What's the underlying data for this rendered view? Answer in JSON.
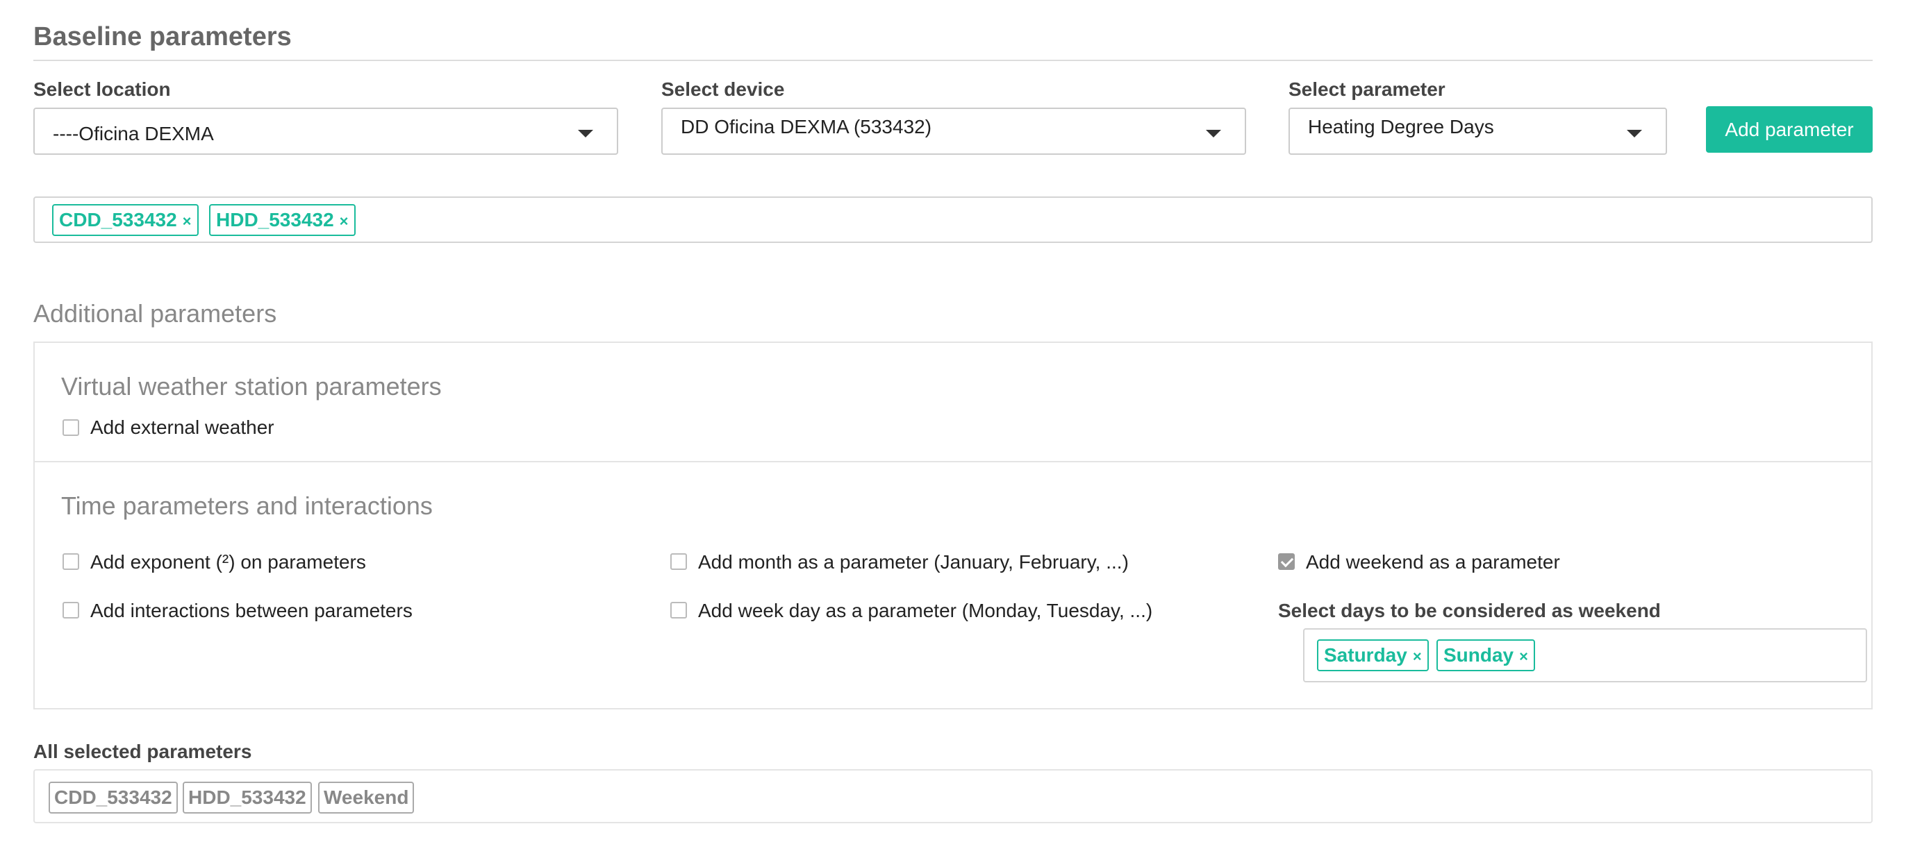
{
  "baseline": {
    "title": "Baseline parameters",
    "location": {
      "label": "Select location",
      "value": "----Oficina DEXMA"
    },
    "device": {
      "label": "Select device",
      "value": "DD Oficina DEXMA (533432)"
    },
    "parameter": {
      "label": "Select parameter",
      "value": "Heating Degree Days"
    },
    "add_button": "Add parameter",
    "tags": [
      "CDD_533432",
      "HDD_533432"
    ],
    "tag_remove": "×"
  },
  "additional": {
    "title": "Additional parameters",
    "weather": {
      "title": "Virtual weather station parameters",
      "add_external_weather": {
        "label": "Add external weather",
        "checked": false
      }
    },
    "time": {
      "title": "Time parameters and interactions",
      "exponent": {
        "label": "Add exponent (²) on parameters",
        "checked": false
      },
      "interactions": {
        "label": "Add interactions between parameters",
        "checked": false
      },
      "month": {
        "label": "Add month as a parameter (January, February, ...)",
        "checked": false
      },
      "weekday": {
        "label": "Add week day as a parameter (Monday, Tuesday, ...)",
        "checked": false
      },
      "weekend": {
        "label": "Add weekend as a parameter",
        "checked": true
      },
      "weekend_days_label": "Select days to be considered as weekend",
      "weekend_days": [
        "Saturday",
        "Sunday"
      ],
      "tag_remove": "×"
    }
  },
  "selected": {
    "label": "All selected parameters",
    "items": [
      "CDD_533432",
      "HDD_533432",
      "Weekend"
    ]
  },
  "colors": {
    "accent": "#1abc9c"
  }
}
